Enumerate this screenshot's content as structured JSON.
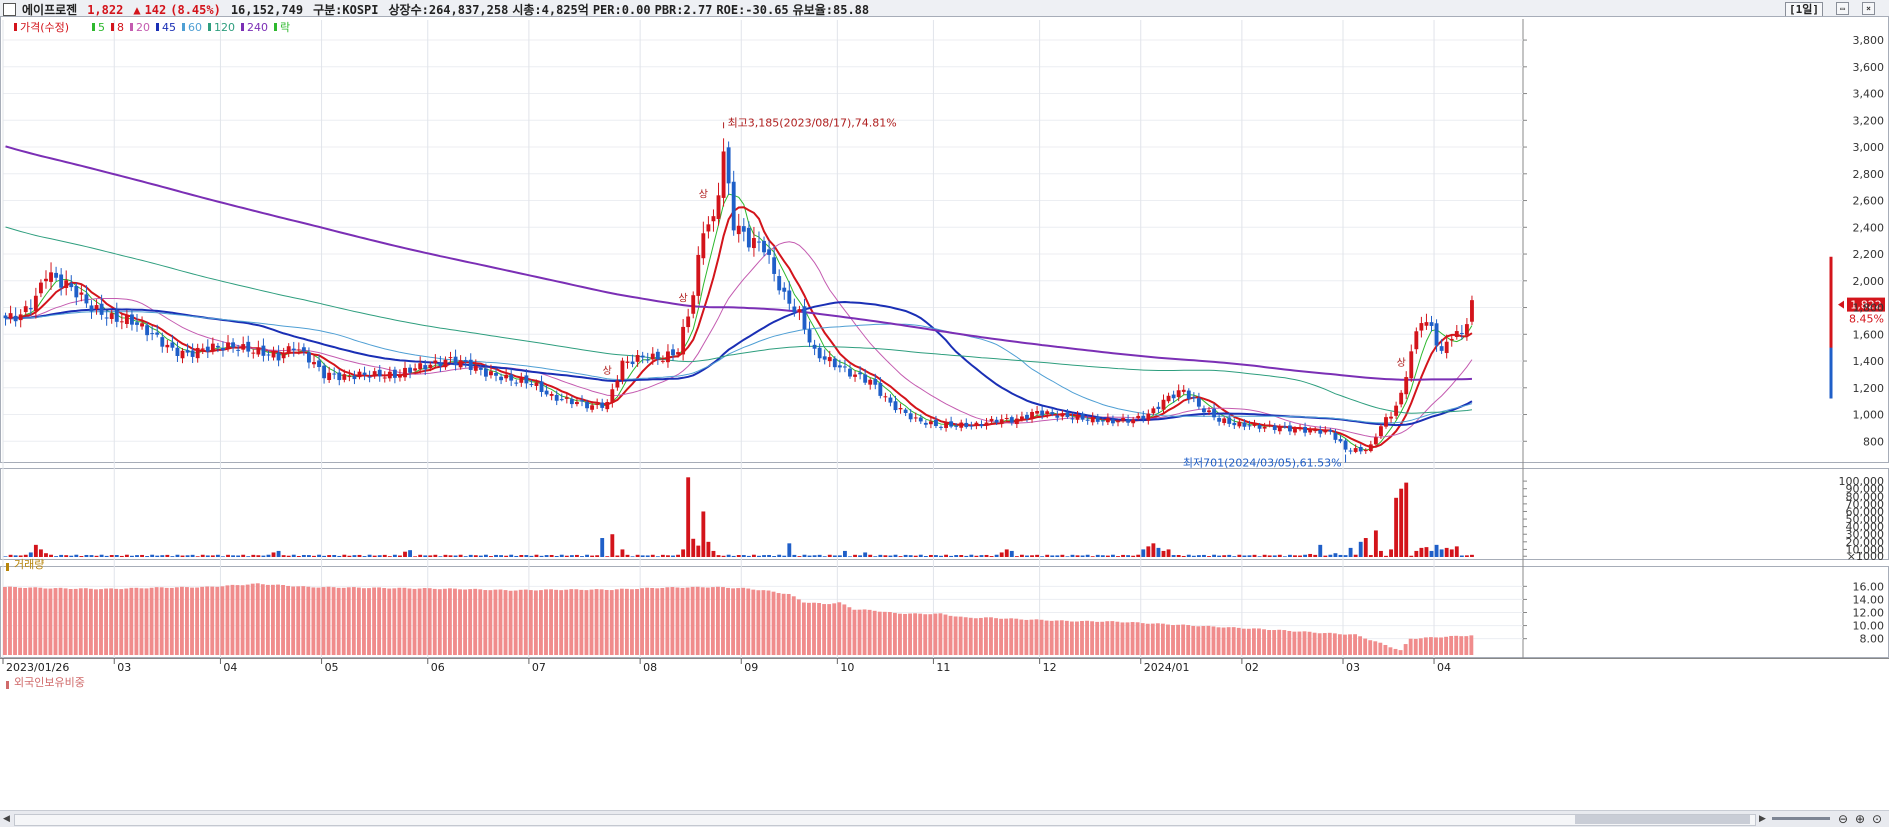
{
  "header": {
    "name": "에이프로젠",
    "price": "1,822",
    "change_arrow": "▲",
    "change": "142",
    "change_pct": "(8.45%)",
    "volume": "16,152,749",
    "market": "구분:KOSPI",
    "shares": "상장수:264,837,258",
    "mktcap": "시총:4,825억",
    "per": "PER:0.00",
    "pbr": "PBR:2.77",
    "roe": "ROE:-30.65",
    "float": "유보율:85.88",
    "period": "[1일]"
  },
  "legend": [
    {
      "label": "가격(수정)",
      "color": "#d3141b"
    },
    {
      "label": "5",
      "color": "#2eb82e"
    },
    {
      "label": "8",
      "color": "#d3141b"
    },
    {
      "label": "20",
      "color": "#c45bb0"
    },
    {
      "label": "45",
      "color": "#1a2fb5"
    },
    {
      "label": "60",
      "color": "#4f9fd4"
    },
    {
      "label": "120",
      "color": "#2e9e7e"
    },
    {
      "label": "240",
      "color": "#7b2fb5"
    },
    {
      "label": "락",
      "color": "#2eb82e"
    }
  ],
  "panels": {
    "volume_title": "거래량",
    "foreign_title": "외국인보유비중"
  },
  "colors": {
    "up": "#d3141b",
    "down": "#1f5fc8",
    "foreign_bar": "#f08c8c"
  },
  "chart_data": [
    {
      "type": "candlestick",
      "title": "에이프로젠",
      "ylim": [
        660,
        3950
      ],
      "yticks": [
        800,
        1000,
        1200,
        1400,
        1600,
        1800,
        2000,
        2200,
        2400,
        2600,
        2800,
        3000,
        3200,
        3400,
        3600,
        3800
      ],
      "ytick_labels": [
        "800",
        "1,000",
        "1,200",
        "1,400",
        "1,600",
        "1,800",
        "2,000",
        "2,200",
        "2,400",
        "2,600",
        "2,800",
        "3,000",
        "3,200",
        "3,400",
        "3,600",
        "3,800"
      ],
      "x_labels": [
        "2023/01/26",
        "03",
        "04",
        "05",
        "06",
        "07",
        "08",
        "09",
        "10",
        "11",
        "12",
        "2024/01",
        "02",
        "03",
        "04"
      ],
      "x_label_days": [
        0,
        22,
        43,
        63,
        84,
        104,
        126,
        146,
        165,
        184,
        205,
        225,
        245,
        265,
        283
      ],
      "total_days": 300,
      "close_anchors": [
        [
          0,
          1720
        ],
        [
          3,
          1740
        ],
        [
          6,
          1870
        ],
        [
          8,
          2060
        ],
        [
          10,
          2010
        ],
        [
          13,
          1950
        ],
        [
          17,
          1800
        ],
        [
          21,
          1720
        ],
        [
          25,
          1700
        ],
        [
          29,
          1600
        ],
        [
          33,
          1480
        ],
        [
          36,
          1450
        ],
        [
          40,
          1500
        ],
        [
          45,
          1510
        ],
        [
          50,
          1470
        ],
        [
          54,
          1430
        ],
        [
          57,
          1510
        ],
        [
          60,
          1420
        ],
        [
          63,
          1300
        ],
        [
          67,
          1280
        ],
        [
          71,
          1300
        ],
        [
          77,
          1290
        ],
        [
          81,
          1350
        ],
        [
          84,
          1370
        ],
        [
          88,
          1410
        ],
        [
          91,
          1380
        ],
        [
          95,
          1310
        ],
        [
          100,
          1260
        ],
        [
          104,
          1240
        ],
        [
          108,
          1130
        ],
        [
          112,
          1100
        ],
        [
          116,
          1060
        ],
        [
          119,
          1080
        ],
        [
          122,
          1380
        ],
        [
          126,
          1430
        ],
        [
          130,
          1420
        ],
        [
          133,
          1480
        ],
        [
          136,
          1900
        ],
        [
          138,
          2400
        ],
        [
          140,
          2440
        ],
        [
          142,
          2950
        ],
        [
          144,
          2430
        ],
        [
          147,
          2300
        ],
        [
          150,
          2260
        ],
        [
          152,
          2050
        ],
        [
          154,
          1880
        ],
        [
          157,
          1750
        ],
        [
          160,
          1460
        ],
        [
          163,
          1400
        ],
        [
          167,
          1310
        ],
        [
          171,
          1250
        ],
        [
          175,
          1080
        ],
        [
          180,
          960
        ],
        [
          184,
          920
        ],
        [
          188,
          920
        ],
        [
          192,
          920
        ],
        [
          196,
          960
        ],
        [
          200,
          960
        ],
        [
          204,
          1020
        ],
        [
          207,
          1000
        ],
        [
          211,
          980
        ],
        [
          215,
          960
        ],
        [
          219,
          950
        ],
        [
          223,
          960
        ],
        [
          226,
          1000
        ],
        [
          230,
          1130
        ],
        [
          233,
          1180
        ],
        [
          236,
          1060
        ],
        [
          240,
          960
        ],
        [
          243,
          930
        ],
        [
          248,
          910
        ],
        [
          252,
          900
        ],
        [
          258,
          880
        ],
        [
          262,
          870
        ],
        [
          265,
          740
        ],
        [
          268,
          730
        ],
        [
          270,
          760
        ],
        [
          272,
          920
        ],
        [
          274,
          1000
        ],
        [
          276,
          1140
        ],
        [
          278,
          1470
        ],
        [
          280,
          1720
        ],
        [
          282,
          1640
        ],
        [
          284,
          1460
        ],
        [
          286,
          1600
        ],
        [
          288,
          1600
        ],
        [
          290,
          1822
        ]
      ],
      "annotations": [
        {
          "text": "최고3,185(2023/08/17),74.81%",
          "day": 142,
          "value": 3185
        },
        {
          "text": "최저701(2024/03/05),61.53%",
          "day": 265,
          "value": 701
        }
      ],
      "markers": [
        {
          "text": "상",
          "day": 119
        },
        {
          "text": "상",
          "day": 134
        },
        {
          "text": "상",
          "day": 138
        },
        {
          "text": "상",
          "day": 276
        }
      ],
      "last": {
        "value": "1,822",
        "pct": "8.45%"
      }
    },
    {
      "type": "bar",
      "title": "거래량",
      "ylim": [
        0,
        112000
      ],
      "yticks": [
        1000,
        10000,
        20000,
        30000,
        40000,
        50000,
        60000,
        70000,
        80000,
        90000,
        100000
      ],
      "ytick_labels": [
        "×1000",
        "10,000",
        "20,000",
        "30,000",
        "40,000",
        "50,000",
        "60,000",
        "70,000",
        "80,000",
        "90,000",
        "100,000"
      ],
      "spikes": [
        [
          5,
          6000
        ],
        [
          6,
          16000
        ],
        [
          7,
          10000
        ],
        [
          8,
          5000
        ],
        [
          53,
          6000
        ],
        [
          54,
          8000
        ],
        [
          79,
          7000
        ],
        [
          80,
          9000
        ],
        [
          118,
          25000
        ],
        [
          120,
          30000
        ],
        [
          122,
          10000
        ],
        [
          134,
          10000
        ],
        [
          135,
          105000
        ],
        [
          136,
          24000
        ],
        [
          137,
          15000
        ],
        [
          138,
          60000
        ],
        [
          139,
          20000
        ],
        [
          140,
          8000
        ],
        [
          155,
          18000
        ],
        [
          166,
          8000
        ],
        [
          170,
          6000
        ],
        [
          197,
          6000
        ],
        [
          198,
          10000
        ],
        [
          199,
          8000
        ],
        [
          225,
          10000
        ],
        [
          226,
          14000
        ],
        [
          227,
          18000
        ],
        [
          228,
          12000
        ],
        [
          229,
          8000
        ],
        [
          230,
          10000
        ],
        [
          258,
          4000
        ],
        [
          260,
          16000
        ],
        [
          263,
          5000
        ],
        [
          266,
          12000
        ],
        [
          268,
          20000
        ],
        [
          269,
          25000
        ],
        [
          271,
          35000
        ],
        [
          272,
          8000
        ],
        [
          274,
          10000
        ],
        [
          275,
          78000
        ],
        [
          276,
          90000
        ],
        [
          277,
          98000
        ],
        [
          279,
          8000
        ],
        [
          280,
          12000
        ],
        [
          281,
          13000
        ],
        [
          282,
          8000
        ],
        [
          283,
          16000
        ],
        [
          284,
          10000
        ],
        [
          285,
          12000
        ],
        [
          286,
          10000
        ],
        [
          287,
          14000
        ]
      ]
    },
    {
      "type": "bar",
      "title": "외국인보유비중",
      "ylim": [
        5.5,
        18.5
      ],
      "yticks": [
        8,
        10,
        12,
        14,
        16
      ],
      "ytick_labels": [
        "8.00",
        "10.00",
        "12.00",
        "14.00",
        "16.00"
      ],
      "anchors": [
        [
          0,
          15.9
        ],
        [
          10,
          15.7
        ],
        [
          20,
          15.6
        ],
        [
          30,
          15.8
        ],
        [
          40,
          15.9
        ],
        [
          50,
          16.4
        ],
        [
          60,
          15.9
        ],
        [
          70,
          15.8
        ],
        [
          80,
          15.7
        ],
        [
          90,
          15.6
        ],
        [
          100,
          15.4
        ],
        [
          110,
          15.5
        ],
        [
          120,
          15.5
        ],
        [
          130,
          15.8
        ],
        [
          140,
          15.9
        ],
        [
          146,
          15.7
        ],
        [
          150,
          15.4
        ],
        [
          155,
          14.8
        ],
        [
          158,
          13.6
        ],
        [
          162,
          13.3
        ],
        [
          165,
          13.5
        ],
        [
          168,
          12.5
        ],
        [
          172,
          12.3
        ],
        [
          176,
          11.9
        ],
        [
          180,
          11.8
        ],
        [
          185,
          11.8
        ],
        [
          190,
          11.2
        ],
        [
          195,
          11.2
        ],
        [
          200,
          11.0
        ],
        [
          210,
          10.7
        ],
        [
          220,
          10.6
        ],
        [
          230,
          10.2
        ],
        [
          240,
          9.8
        ],
        [
          250,
          9.4
        ],
        [
          260,
          8.9
        ],
        [
          267,
          8.6
        ],
        [
          272,
          7.3
        ],
        [
          276,
          6.2
        ],
        [
          278,
          8.0
        ],
        [
          285,
          8.3
        ],
        [
          290,
          8.5
        ]
      ]
    }
  ]
}
